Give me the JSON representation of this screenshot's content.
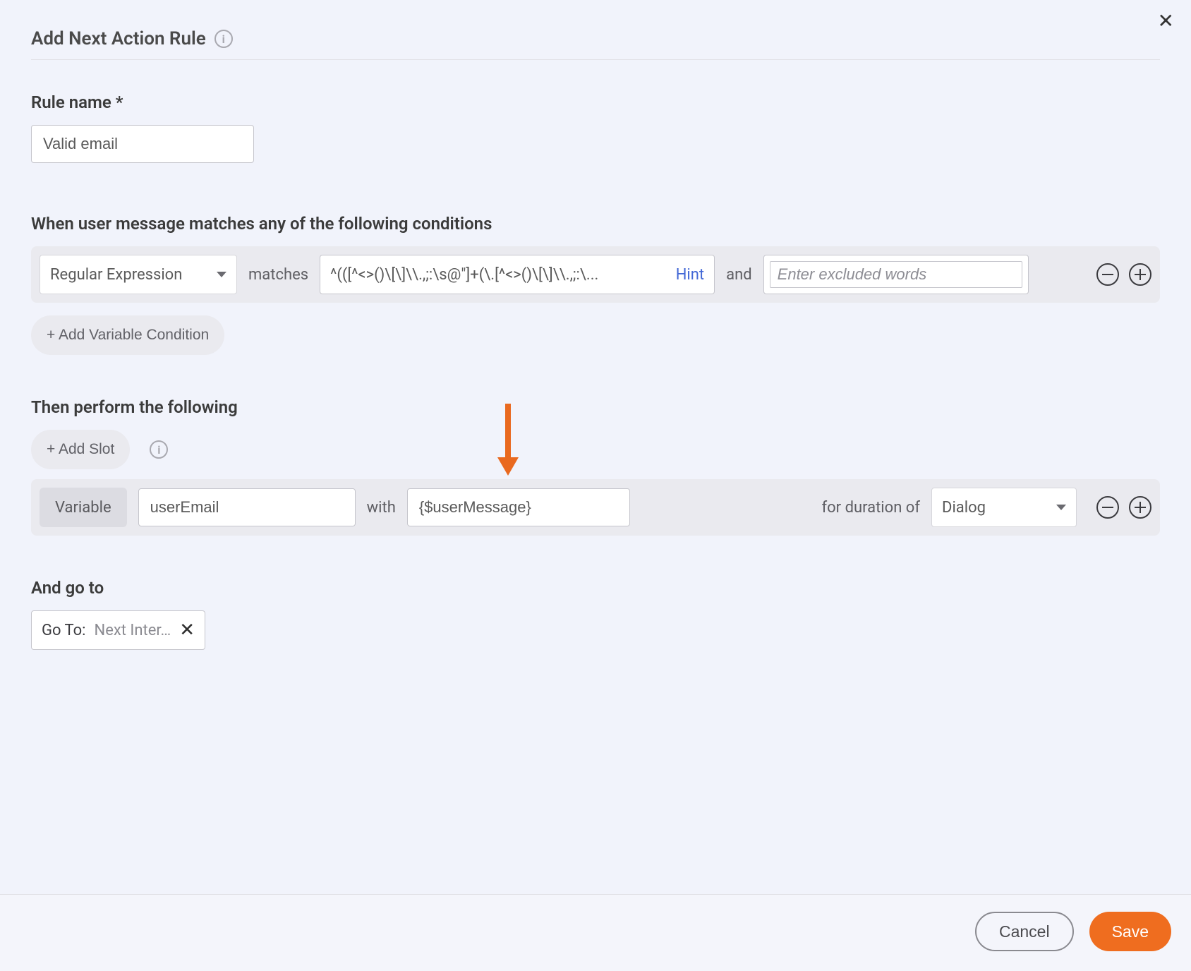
{
  "header": {
    "title": "Add Next Action Rule"
  },
  "rule_name": {
    "label": "Rule name *",
    "value": "Valid email"
  },
  "conditions": {
    "heading": "When user message matches any of the following conditions",
    "type_selected": "Regular Expression",
    "matches_text": "matches",
    "regex_value": "^(([^<>()\\[\\]\\\\.,;:\\s@\"]+(\\.[^<>()\\[\\]\\\\.,;:\\...",
    "hint_label": "Hint",
    "and_text": "and",
    "excluded_placeholder": "Enter excluded words",
    "add_variable_condition_label": "+ Add Variable Condition"
  },
  "actions": {
    "heading": "Then perform the following",
    "add_slot_label": "+ Add Slot",
    "variable_label": "Variable",
    "variable_name": "userEmail",
    "with_text": "with",
    "variable_value": "{$userMessage}",
    "duration_text": "for duration of",
    "duration_selected": "Dialog"
  },
  "goto": {
    "heading": "And go to",
    "prefix": "Go To:",
    "value": "Next Inter…"
  },
  "footer": {
    "cancel_label": "Cancel",
    "save_label": "Save"
  }
}
